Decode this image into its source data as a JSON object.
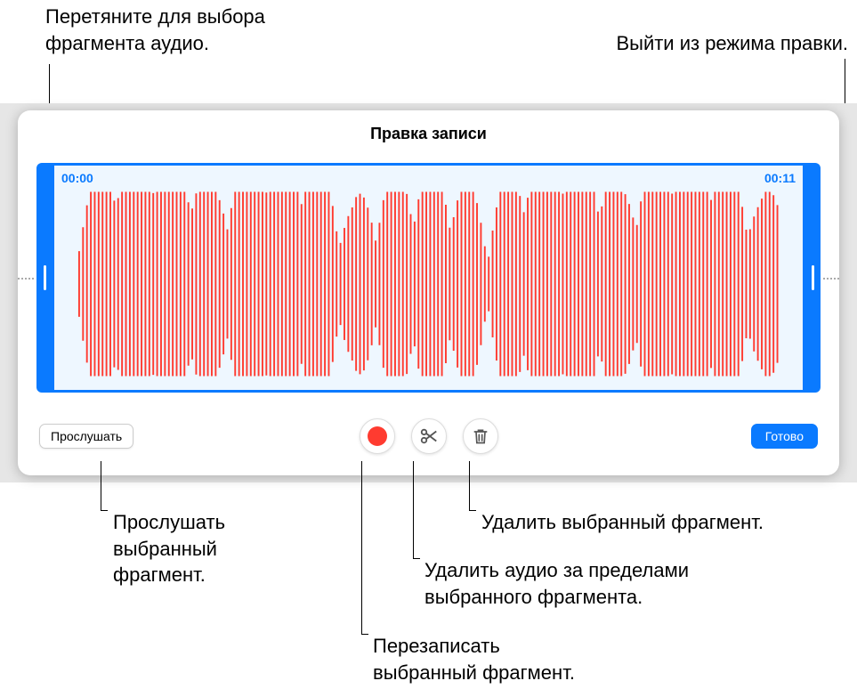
{
  "callouts": {
    "drag_select": "Перетяните для выбора\nфрагмента аудио.",
    "exit_edit": "Выйти из режима правки.",
    "listen_selected": "Прослушать\nвыбранный\nфрагмент.",
    "delete_selected": "Удалить выбранный фрагмент.",
    "trim_outside": "Удалить аудио за пределами\nвыбранного фрагмента.",
    "rerecord": "Перезаписать\nвыбранный фрагмент."
  },
  "window": {
    "title": "Правка записи",
    "time_start": "00:00",
    "time_end": "00:11",
    "buttons": {
      "listen": "Прослушать",
      "done": "Готово"
    },
    "icons": {
      "record": "record-icon",
      "trim": "scissors-icon",
      "delete": "trash-icon"
    }
  },
  "colors": {
    "accent": "#0a7aff",
    "record": "#ff3b30",
    "waveform": "#ff3b30"
  }
}
